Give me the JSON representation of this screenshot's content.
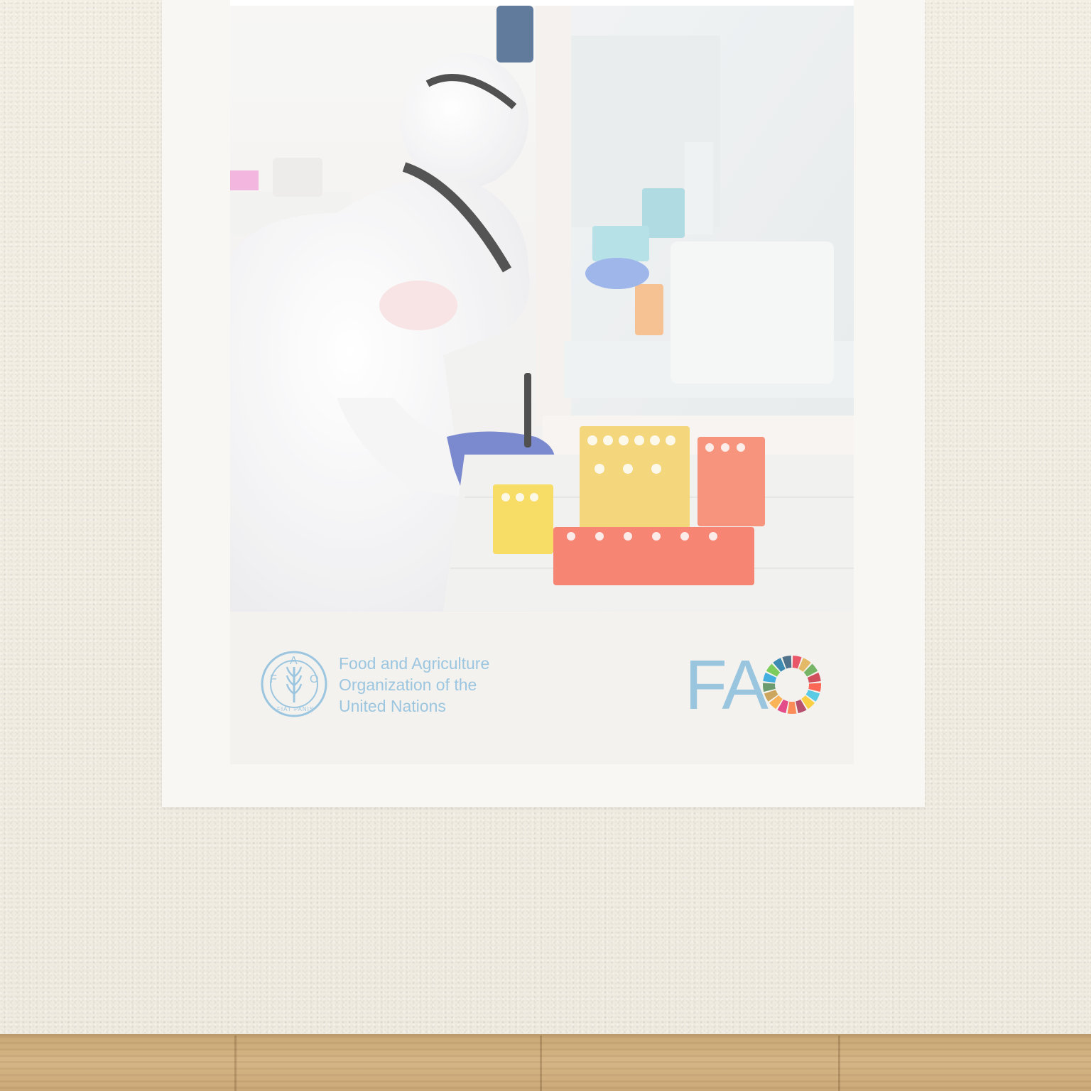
{
  "footer": {
    "org_lines": [
      "Food and Agriculture",
      "Organization of the",
      "United Nations"
    ],
    "wordmark": "FA",
    "emblem_letters": {
      "f": "F",
      "a": "A",
      "o": "O"
    },
    "emblem_motto": "FIAT PANIS"
  },
  "colors": {
    "brand_blue": "#9cc6e0",
    "sdg_wheel": [
      "#e5243b",
      "#dda63a",
      "#4c9f38",
      "#c5192d",
      "#ff3a21",
      "#26bde2",
      "#fcc30b",
      "#a21942",
      "#fd6925",
      "#dd1367",
      "#fd9d24",
      "#bf8b2e",
      "#3f7e44",
      "#0a97d9",
      "#56c02b",
      "#00689d",
      "#19486a"
    ]
  },
  "icons": {
    "emblem": "fao-emblem-icon",
    "wheel": "sdg-wheel-icon"
  }
}
